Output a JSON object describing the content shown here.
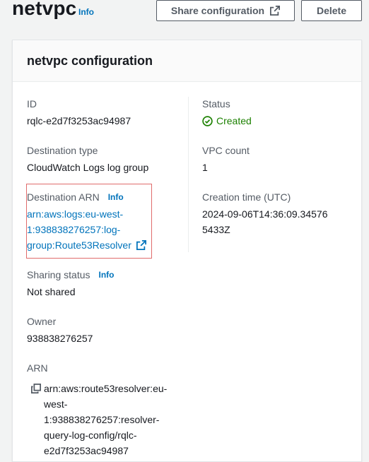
{
  "header": {
    "title": "netvpc",
    "info": "Info",
    "share_button": "Share configuration",
    "delete_button": "Delete"
  },
  "panel": {
    "title": "netvpc configuration",
    "id": {
      "label": "ID",
      "value": "rqlc-e2d7f3253ac94987"
    },
    "status": {
      "label": "Status",
      "value": "Created",
      "color": "#1d8102"
    },
    "destination_type": {
      "label": "Destination type",
      "value": "CloudWatch Logs log group"
    },
    "vpc_count": {
      "label": "VPC count",
      "value": "1"
    },
    "destination_arn": {
      "label": "Destination ARN",
      "info": "Info",
      "value": "arn:aws:logs:eu-west-1:938838276257:log-group:Route53Resolver"
    },
    "creation_time": {
      "label": "Creation time (UTC)",
      "value": "2024-09-06T14:36:09.345765433Z"
    },
    "sharing_status": {
      "label": "Sharing status",
      "info": "Info",
      "value": "Not shared"
    },
    "owner": {
      "label": "Owner",
      "value": "938838276257"
    },
    "arn": {
      "label": "ARN",
      "value": "arn:aws:route53resolver:eu-west-1:938838276257:resolver-query-log-config/rqlc-e2d7f3253ac94987"
    }
  },
  "colors": {
    "link": "#0073bb",
    "highlight_border": "#e06c6c",
    "success": "#1d8102"
  },
  "icons": [
    "external-link-icon",
    "check-circle-icon",
    "copy-icon"
  ]
}
